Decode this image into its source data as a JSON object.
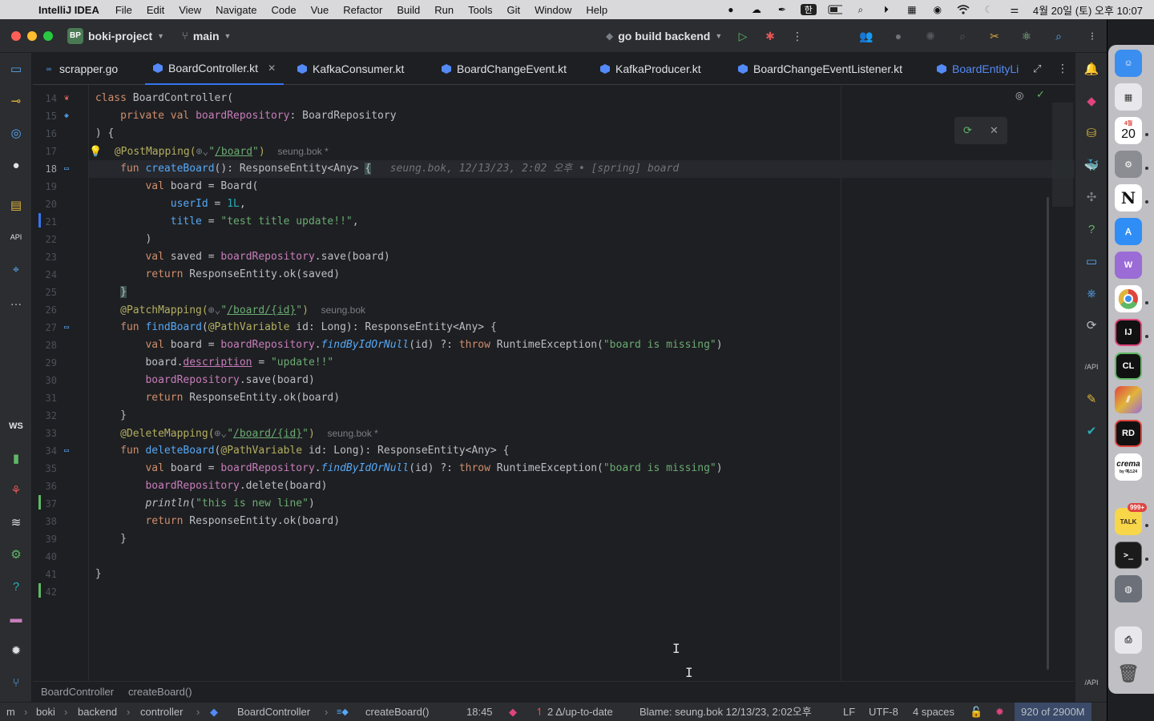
{
  "menubar": {
    "app_name": "IntelliJ IDEA",
    "items": [
      "File",
      "Edit",
      "View",
      "Navigate",
      "Code",
      "Vue",
      "Refactor",
      "Build",
      "Run",
      "Tools",
      "Git",
      "Window",
      "Help"
    ],
    "input_source": "한",
    "clock": "4월 20일 (토) 오후 10:07"
  },
  "toolbar": {
    "project_badge": "BP",
    "project_name": "boki-project",
    "branch": "main",
    "run_config": "go build backend"
  },
  "tabs": [
    {
      "label": "scrapper.go",
      "kind": "go"
    },
    {
      "label": "BoardController.kt",
      "kind": "kotlin",
      "active": true
    },
    {
      "label": "KafkaConsumer.kt",
      "kind": "kotlin"
    },
    {
      "label": "BoardChangeEvent.kt",
      "kind": "kotlin"
    },
    {
      "label": "KafkaProducer.kt",
      "kind": "kotlin"
    },
    {
      "label": "BoardChangeEventListener.kt",
      "kind": "kotlin"
    },
    {
      "label": "BoardEntityLi",
      "kind": "kotlin",
      "partial": true
    }
  ],
  "editor": {
    "line_numbers": [
      "14",
      "15",
      "16",
      "17",
      "18",
      "19",
      "20",
      "21",
      "22",
      "23",
      "24",
      "25",
      "26",
      "27",
      "28",
      "29",
      "30",
      "31",
      "32",
      "33",
      "34",
      "35",
      "36",
      "37",
      "38",
      "39",
      "40",
      "41",
      "42"
    ],
    "current_line": "18",
    "author_hint": "seung.bok *",
    "author_hint_plain": "seung.bok",
    "blame_inline": "seung.bok, 12/13/23, 2:02 오후 • [spring] board"
  },
  "breadcrumb": [
    "BoardController",
    "createBoard()"
  ],
  "statusbar": {
    "path": [
      "m",
      "boki",
      "backend",
      "controller",
      "BoardController",
      "createBoard()"
    ],
    "position": "18:45",
    "vcs": "2 Δ/up-to-date",
    "blame": "Blame: seung.bok 12/13/23, 2:02오후",
    "line_sep": "LF",
    "encoding": "UTF-8",
    "indent": "4 spaces",
    "memory": "920 of 2900M"
  },
  "dock": {
    "apps": [
      "Finder",
      "Launchpad",
      "Calendar",
      "System Settings",
      "Notion",
      "App Store",
      "Weverse",
      "Chrome",
      "IntelliJ IDEA",
      "CLion",
      "Postman",
      "Rider",
      "crema",
      "KakaoTalk",
      "Terminal",
      "Simulator",
      "Preview",
      "Trash"
    ],
    "calendar_month": "4월",
    "calendar_day": "20",
    "kakao_badge": "999+",
    "crema_label": "crema",
    "crema_sub": "by 예스24",
    "intellij_label": "IJ",
    "clion_label": "CL",
    "rider_label": "RD",
    "notion_label": "N",
    "talk_label": "TALK",
    "terminal_label": ">_"
  },
  "left_strip_labels": {
    "ws": "WS"
  },
  "right_strip_labels": {
    "api": "/API"
  },
  "colors": {
    "accent": "#3574f0",
    "keyword": "#cf8e6d",
    "function": "#56a8f5",
    "string": "#6aab73",
    "annotation": "#b3ae60",
    "property": "#c77dbb"
  }
}
